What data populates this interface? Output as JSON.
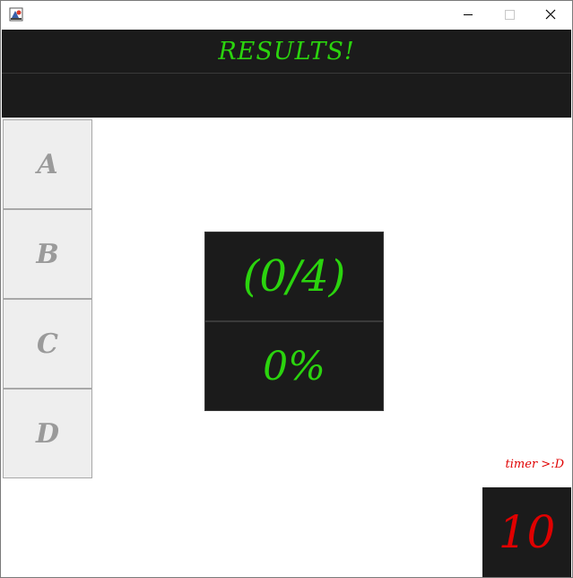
{
  "window": {
    "controls": {
      "minimize_icon": "minimize-icon",
      "maximize_icon": "maximize-icon",
      "close_icon": "close-icon"
    }
  },
  "header": {
    "title": "RESULTS!",
    "title_color": "#2bd40e",
    "background": "#1b1b1b"
  },
  "answers": [
    {
      "label": "A"
    },
    {
      "label": "B"
    },
    {
      "label": "C"
    },
    {
      "label": "D"
    }
  ],
  "score": {
    "fraction": "(0/4)",
    "percent": "0%"
  },
  "timer": {
    "label": "timer >:D",
    "value": "10",
    "color": "#e00000"
  }
}
